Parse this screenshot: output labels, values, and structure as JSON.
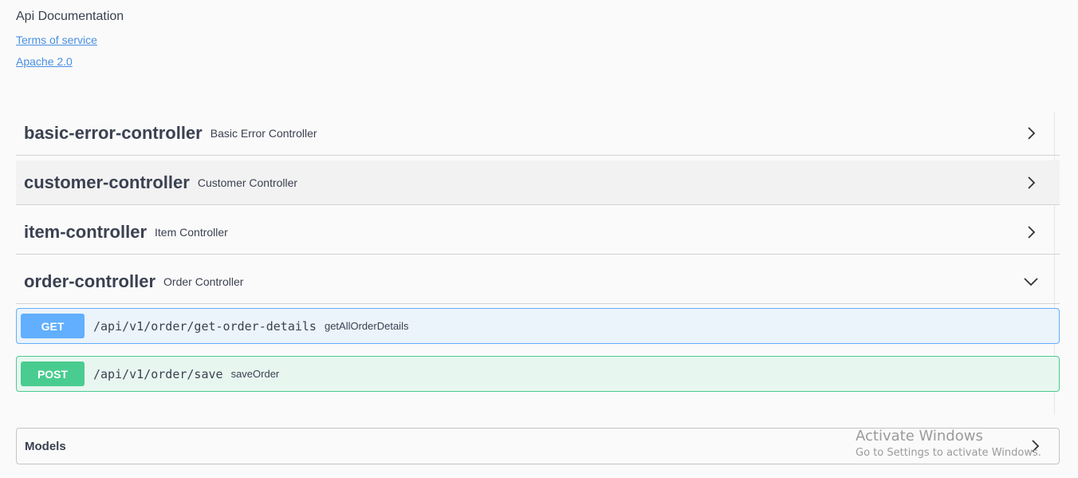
{
  "info": {
    "title": "Api Documentation",
    "terms_link": "Terms of service",
    "license_link": "Apache 2.0"
  },
  "tags": [
    {
      "name": "basic-error-controller",
      "description": "Basic Error Controller",
      "arrow_icon": "chevron-right-icon"
    },
    {
      "name": "customer-controller",
      "description": "Customer Controller",
      "arrow_icon": "chevron-right-icon"
    },
    {
      "name": "item-controller",
      "description": "Item Controller",
      "arrow_icon": "chevron-right-icon"
    },
    {
      "name": "order-controller",
      "description": "Order Controller",
      "arrow_icon": "chevron-down-icon"
    }
  ],
  "operations": [
    {
      "method": "GET",
      "path": "/api/v1/order/get-order-details",
      "summary": "getAllOrderDetails",
      "color": "#61affe"
    },
    {
      "method": "POST",
      "path": "/api/v1/order/save",
      "summary": "saveOrder",
      "color": "#49cc90"
    }
  ],
  "models": {
    "title": "Models",
    "arrow_icon": "chevron-right-icon"
  },
  "watermark": {
    "title": "Activate Windows",
    "subtitle": "Go to Settings to activate Windows."
  },
  "colors": {
    "link": "#4990e2",
    "text": "#3b4151",
    "get": "#61affe",
    "post": "#49cc90"
  }
}
